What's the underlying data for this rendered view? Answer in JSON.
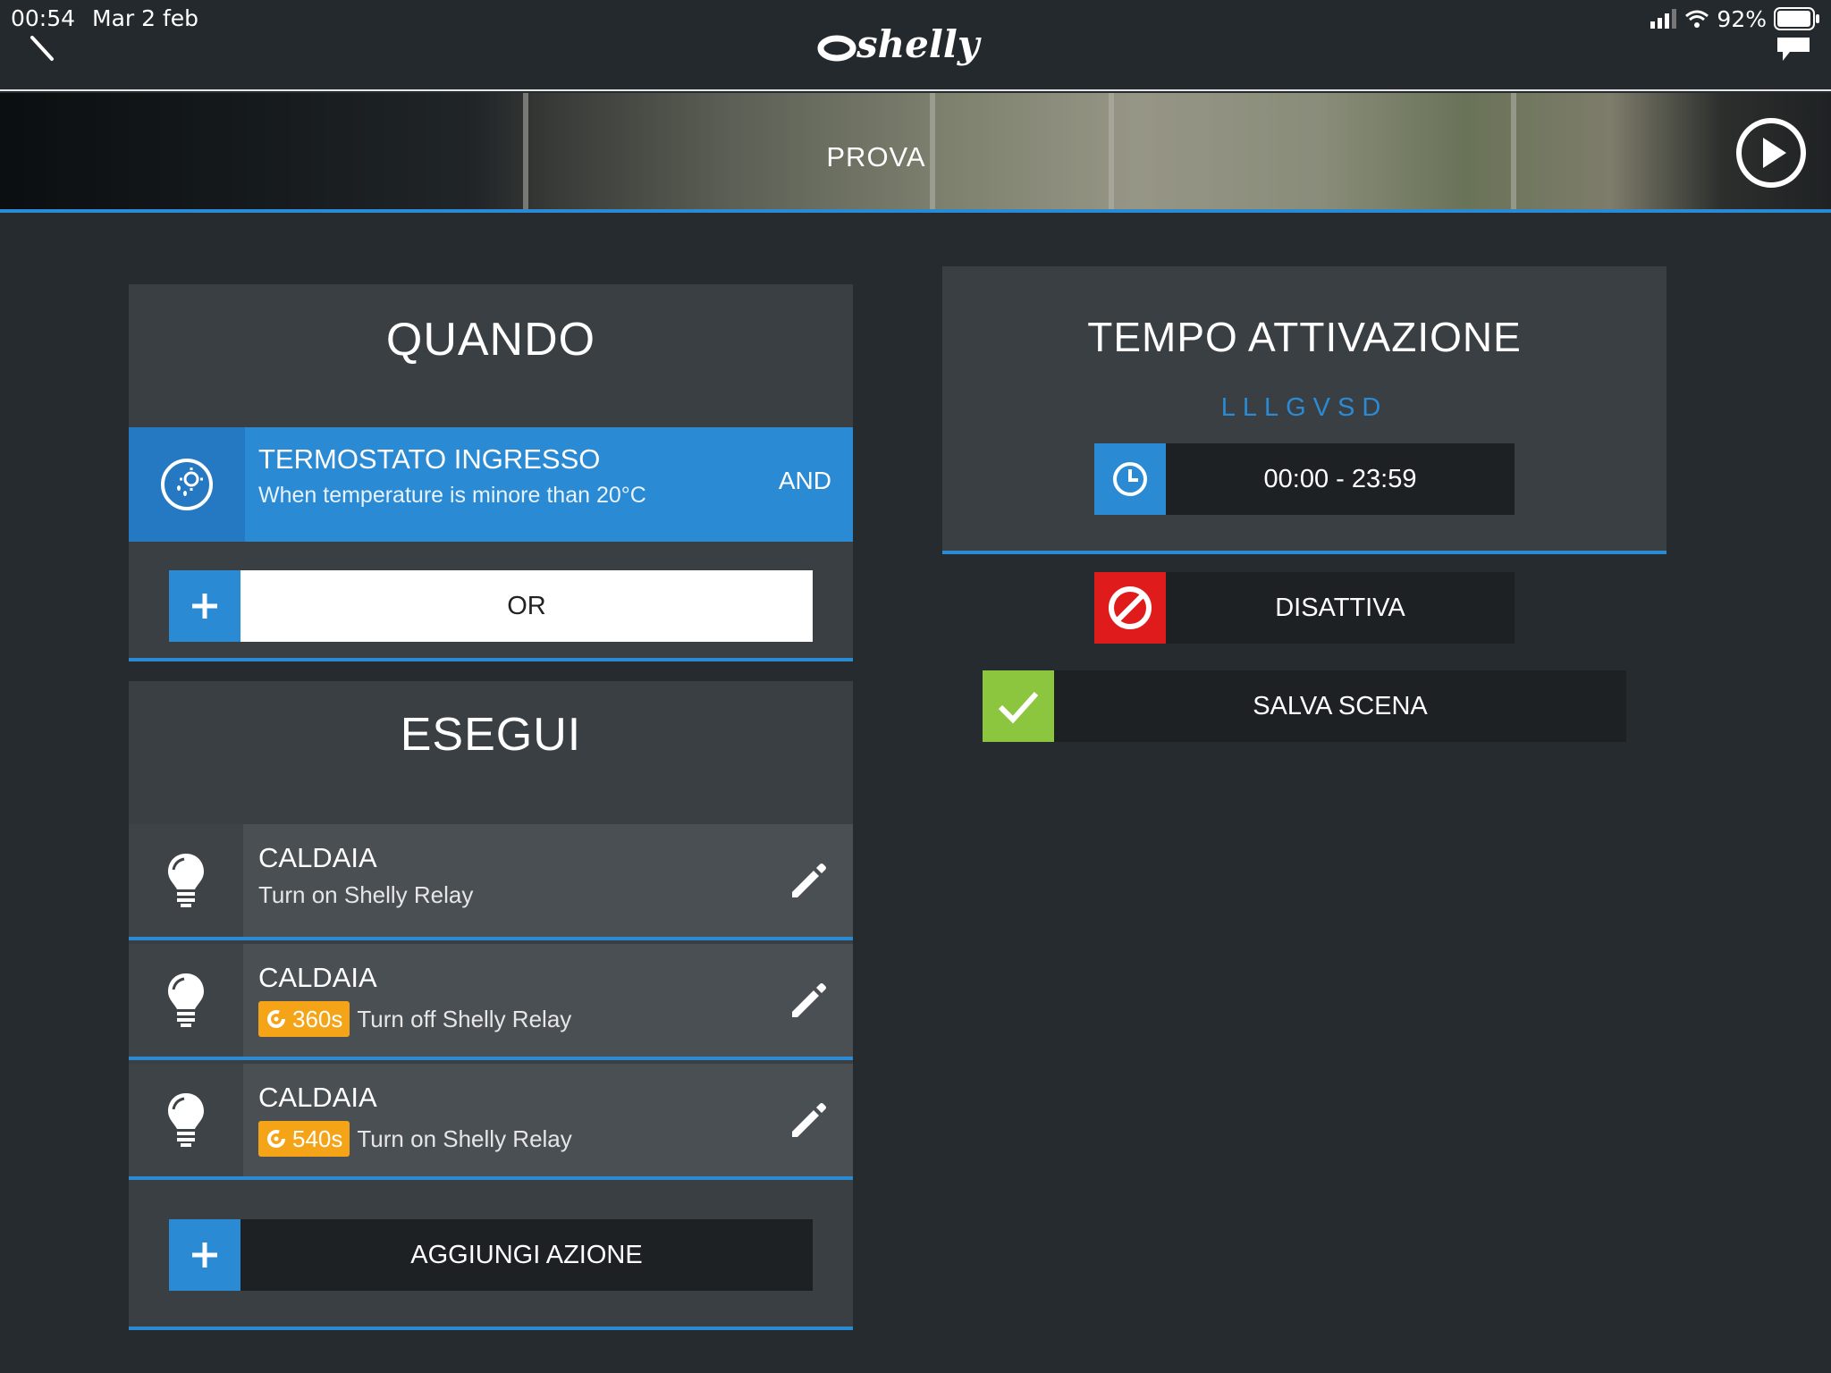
{
  "status_bar": {
    "time": "00:54",
    "date": "Mar 2 feb",
    "battery": "92%"
  },
  "header": {
    "logo_text": "shelly"
  },
  "hero": {
    "title": "PROVA"
  },
  "quando": {
    "title": "QUANDO",
    "condition": {
      "title": "TERMOSTATO INGRESSO",
      "subtitle": "When temperature is minore than 20°C",
      "logic": "AND",
      "icon": "thermostat-weather-icon"
    },
    "or_label": "OR"
  },
  "esegui": {
    "title": "ESEGUI",
    "actions": [
      {
        "title": "CALDAIA",
        "subtitle": "Turn on Shelly Relay",
        "delay": null
      },
      {
        "title": "CALDAIA",
        "subtitle": "Turn off Shelly Relay",
        "delay": "360s"
      },
      {
        "title": "CALDAIA",
        "subtitle": "Turn on Shelly Relay",
        "delay": "540s"
      }
    ],
    "add_action_label": "AGGIUNGI AZIONE"
  },
  "tempo": {
    "title": "TEMPO ATTIVAZIONE",
    "days": "LLLGVSD",
    "time_range": "00:00 - 23:59"
  },
  "buttons": {
    "disable_label": "DISATTIVA",
    "save_label": "SALVA SCENA"
  },
  "colors": {
    "accent_blue": "#2a8ad3",
    "warning_orange": "#f5a417",
    "danger_red": "#e01b1b",
    "success_green": "#8cc63f",
    "panel": "#3a3f43",
    "background": "#262b2f"
  }
}
